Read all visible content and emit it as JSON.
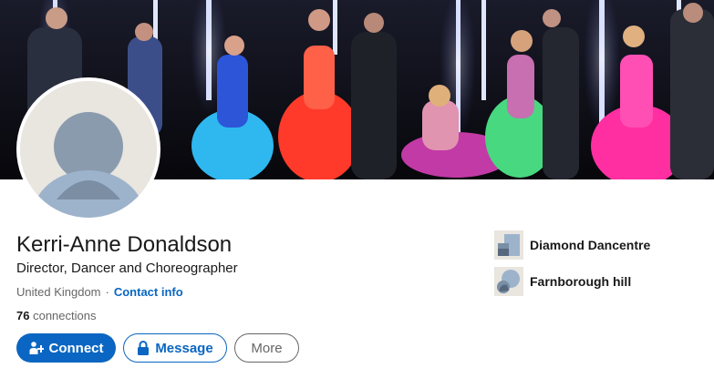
{
  "profile": {
    "name": "Kerri-Anne Donaldson",
    "headline": "Director, Dancer and Choreographer",
    "location": "United Kingdom",
    "separator": "·",
    "contact_info": "Contact info",
    "connections_count": "76",
    "connections_label": "connections"
  },
  "actions": {
    "connect": "Connect",
    "message": "Message",
    "more": "More"
  },
  "organizations": [
    {
      "name": "Diamond Dancentre",
      "icon": "company-logo-icon"
    },
    {
      "name": "Farnborough hill",
      "icon": "school-logo-icon"
    }
  ],
  "colors": {
    "primary": "#0a66c2",
    "text": "#191919",
    "muted": "#666666"
  }
}
